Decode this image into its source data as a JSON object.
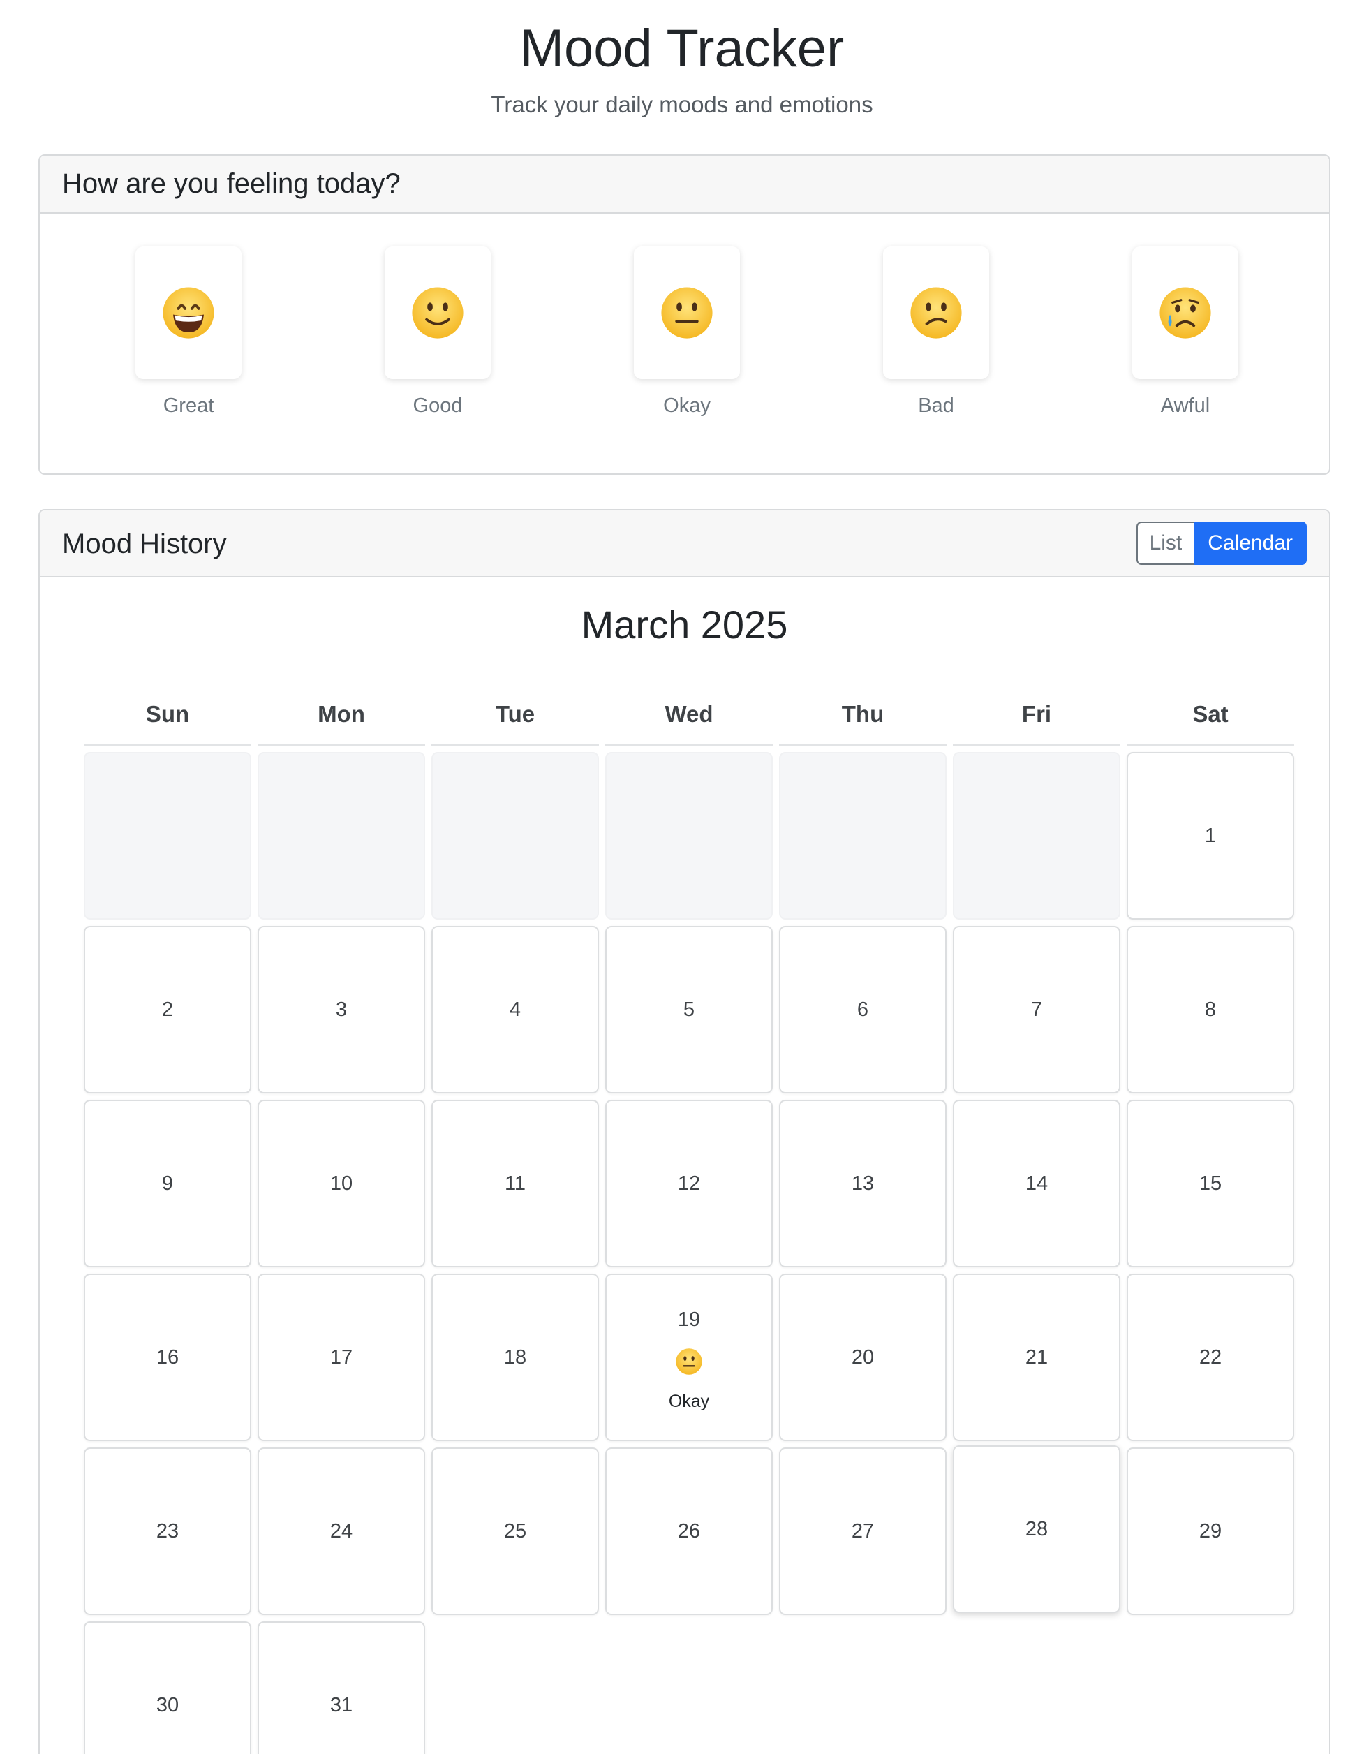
{
  "header": {
    "title": "Mood Tracker",
    "subtitle": "Track your daily moods and emotions"
  },
  "feeling": {
    "title": "How are you feeling today?",
    "options": [
      {
        "label": "Great",
        "icon": "grinning-face-icon"
      },
      {
        "label": "Good",
        "icon": "slightly-smiling-face-icon"
      },
      {
        "label": "Okay",
        "icon": "neutral-face-icon"
      },
      {
        "label": "Bad",
        "icon": "confused-face-icon"
      },
      {
        "label": "Awful",
        "icon": "crying-face-icon"
      }
    ]
  },
  "history": {
    "title": "Mood History",
    "view_toggle": {
      "list_label": "List",
      "calendar_label": "Calendar",
      "active": "Calendar"
    },
    "calendar": {
      "month_title": "March 2025",
      "weekdays": [
        "Sun",
        "Mon",
        "Tue",
        "Wed",
        "Thu",
        "Fri",
        "Sat"
      ],
      "leading_empty_days": 6,
      "days": [
        "1",
        "2",
        "3",
        "4",
        "5",
        "6",
        "7",
        "8",
        "9",
        "10",
        "11",
        "12",
        "13",
        "14",
        "15",
        "16",
        "17",
        "18",
        "19",
        "20",
        "21",
        "22",
        "23",
        "24",
        "25",
        "26",
        "27",
        "28",
        "29",
        "30",
        "31"
      ],
      "entries": [
        {
          "day": "19",
          "mood": "Okay",
          "icon": "neutral-face-icon"
        }
      ]
    }
  },
  "colors": {
    "accent": "#1f6ef5",
    "muted_text": "#6c757d",
    "border": "#d8dadc",
    "header_bg": "#f7f7f7",
    "empty_cell_bg": "#f5f6f8",
    "emoji_yellow": "#ffcc33"
  }
}
